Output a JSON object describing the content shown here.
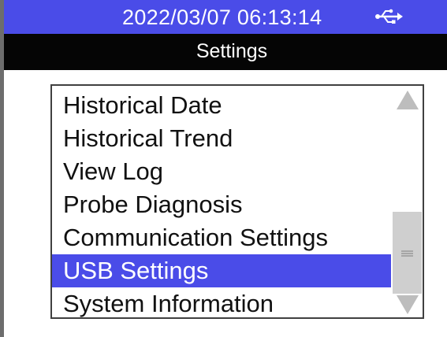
{
  "status_bar": {
    "datetime": "2022/03/07 06:13:14",
    "usb_icon": "usb-icon",
    "background_color": "#4a4ce8"
  },
  "title_bar": {
    "title": "Settings"
  },
  "menu": {
    "items": [
      {
        "label": "Historical Date",
        "selected": false
      },
      {
        "label": "Historical Trend",
        "selected": false
      },
      {
        "label": "View Log",
        "selected": false
      },
      {
        "label": "Probe Diagnosis",
        "selected": false
      },
      {
        "label": "Communication Settings",
        "selected": false
      },
      {
        "label": "USB Settings",
        "selected": true
      },
      {
        "label": "System Information",
        "selected": false
      }
    ],
    "selected_color": "#4a4ce8"
  },
  "scrollbar": {
    "up_icon": "triangle-up-icon",
    "down_icon": "triangle-down-icon",
    "grip_icon": "grip-lines-icon"
  }
}
